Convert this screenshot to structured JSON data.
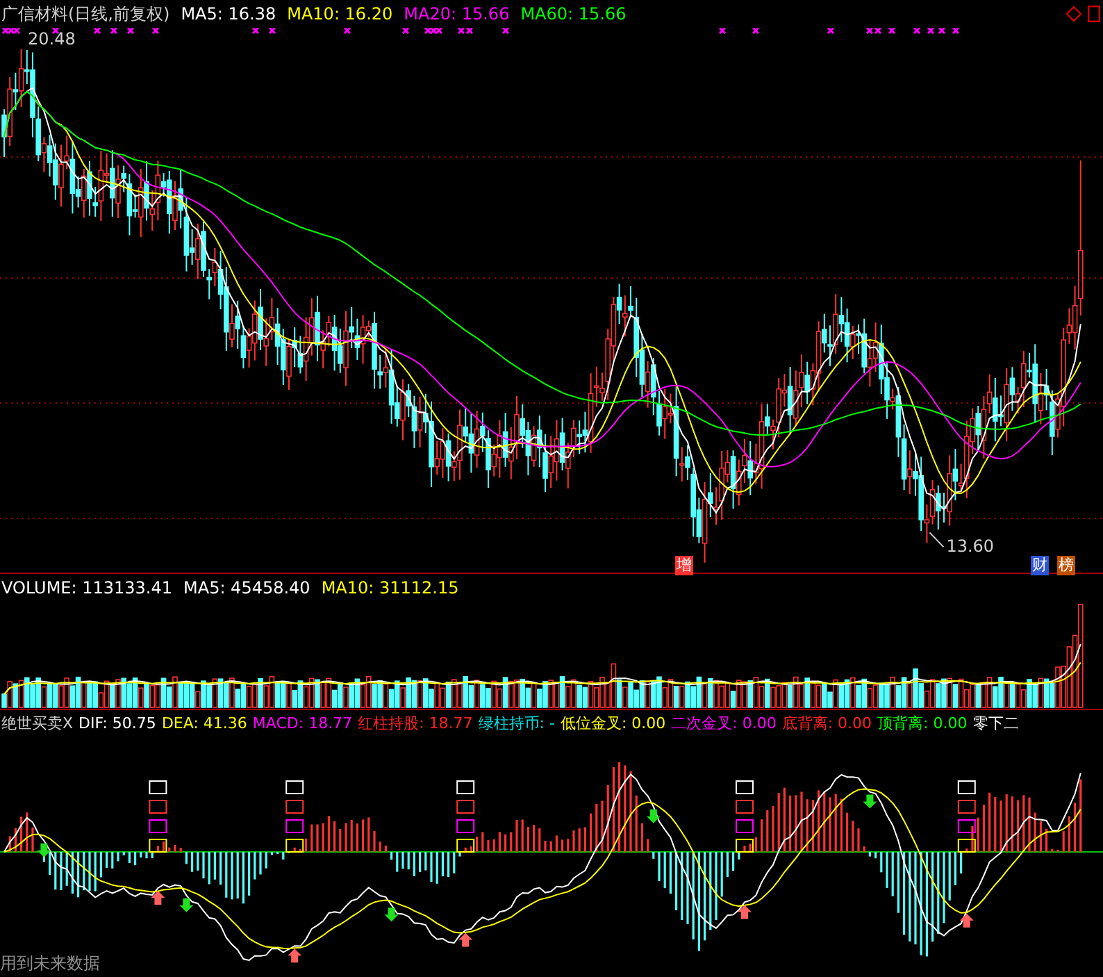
{
  "title_bar": {
    "title": "广信材料(日线,前复权)",
    "indicators": [
      {
        "label": "MA5: 16.38",
        "color": "#ffffff"
      },
      {
        "label": "MA10: 16.20",
        "color": "#ffff00"
      },
      {
        "label": "MA20: 15.66",
        "color": "#ff00ff"
      },
      {
        "label": "MA60: 15.66",
        "color": "#00ff00"
      }
    ]
  },
  "price_panel": {
    "high_label": "20.48",
    "low_label": "13.60",
    "markers": [
      {
        "text": "增",
        "color": "#ff3030"
      },
      {
        "text": "财",
        "color": "#2f55d4"
      },
      {
        "text": "榜",
        "color": "#c05000"
      }
    ]
  },
  "volume_panel": {
    "indicators": [
      {
        "label": "VOLUME: 113133.41",
        "color": "#ffffff"
      },
      {
        "label": "MA5: 45458.40",
        "color": "#ffffff"
      },
      {
        "label": "MA10: 31112.15",
        "color": "#ffff00"
      }
    ]
  },
  "macd_panel": {
    "name": "绝世买卖X",
    "indicators": [
      {
        "label": "DIF: 50.75",
        "color": "#ffffff"
      },
      {
        "label": "DEA: 41.36",
        "color": "#ffff00"
      },
      {
        "label": "MACD: 18.77",
        "color": "#ff00ff"
      },
      {
        "label": "红柱持股: 18.77",
        "color": "#ff2020"
      },
      {
        "label": "绿柱持币: -",
        "color": "#00e0e0"
      },
      {
        "label": "低位金叉: 0.00",
        "color": "#ffff00"
      },
      {
        "label": "二次金叉: 0.00",
        "color": "#ff00ff"
      },
      {
        "label": "底背离: 0.00",
        "color": "#ff2020"
      },
      {
        "label": "顶背离: 0.00",
        "color": "#00ff00"
      },
      {
        "label": "零下二",
        "color": "#ffffff"
      }
    ]
  },
  "footer_note": "用到未来数据"
}
